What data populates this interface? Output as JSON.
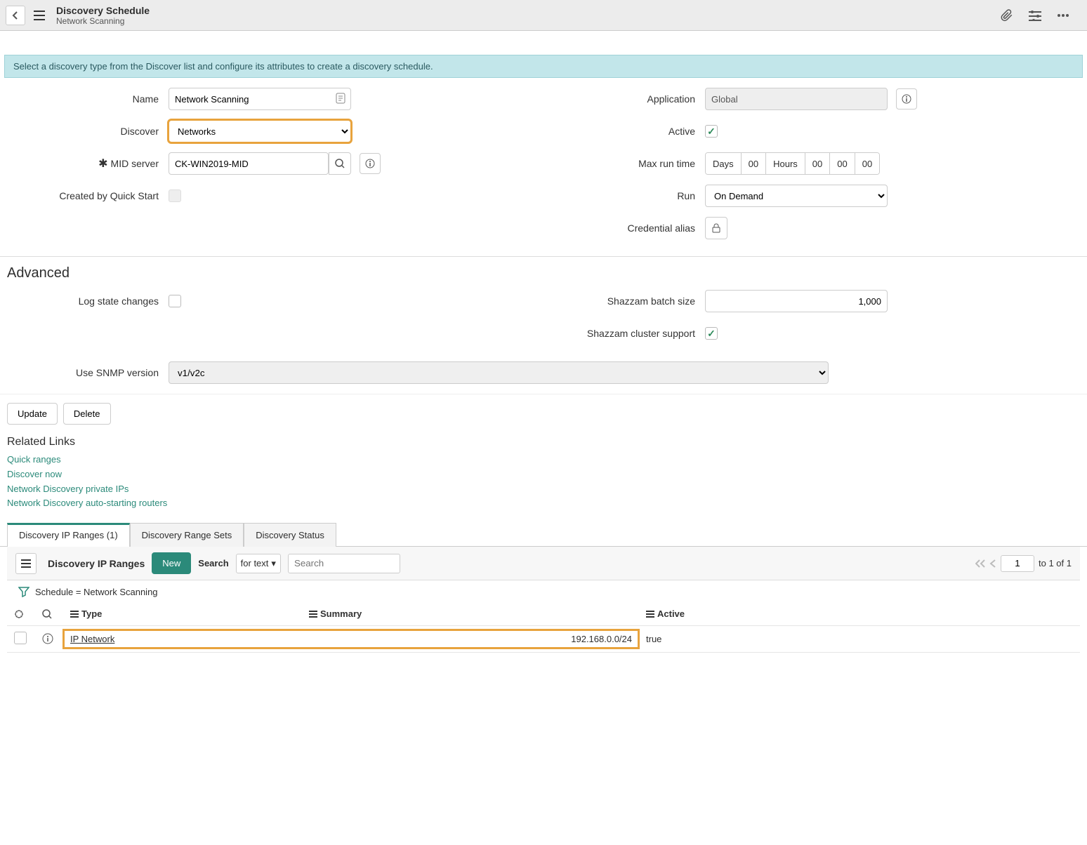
{
  "header": {
    "title": "Discovery Schedule",
    "subtitle": "Network Scanning"
  },
  "banner": "Select a discovery type from the Discover list and configure its attributes to create a discovery schedule.",
  "form": {
    "labels": {
      "name": "Name",
      "discover": "Discover",
      "mid_server": "MID server",
      "created_by_quick_start": "Created by Quick Start",
      "application": "Application",
      "active": "Active",
      "max_run_time": "Max run time",
      "run": "Run",
      "credential_alias": "Credential alias"
    },
    "values": {
      "name": "Network Scanning",
      "discover": "Networks",
      "mid_server": "CK-WIN2019-MID",
      "application": "Global",
      "run": "On Demand",
      "duration": {
        "days_label": "Days",
        "days": "00",
        "hours_label": "Hours",
        "h": "00",
        "m": "00",
        "s": "00"
      }
    }
  },
  "advanced": {
    "heading": "Advanced",
    "labels": {
      "log_state_changes": "Log state changes",
      "shazzam_batch_size": "Shazzam batch size",
      "shazzam_cluster_support": "Shazzam cluster support",
      "use_snmp_version": "Use SNMP version"
    },
    "values": {
      "shazzam_batch_size": "1,000",
      "snmp": "v1/v2c"
    }
  },
  "buttons": {
    "update": "Update",
    "delete": "Delete"
  },
  "related": {
    "heading": "Related Links",
    "links": [
      "Quick ranges",
      "Discover now",
      "Network Discovery private IPs",
      "Network Discovery auto-starting routers"
    ]
  },
  "tabs": [
    "Discovery IP Ranges (1)",
    "Discovery Range Sets",
    "Discovery Status"
  ],
  "list": {
    "toolbar": {
      "title": "Discovery IP Ranges",
      "new_label": "New",
      "search_label": "Search",
      "search_mode": "for text",
      "search_placeholder": "Search",
      "page": "1",
      "page_text": "to 1 of 1"
    },
    "filter_text": "Schedule = Network Scanning",
    "columns": {
      "type": "Type",
      "summary": "Summary",
      "active": "Active"
    },
    "rows": [
      {
        "type": "IP Network",
        "summary": "192.168.0.0/24",
        "active": "true"
      }
    ]
  }
}
